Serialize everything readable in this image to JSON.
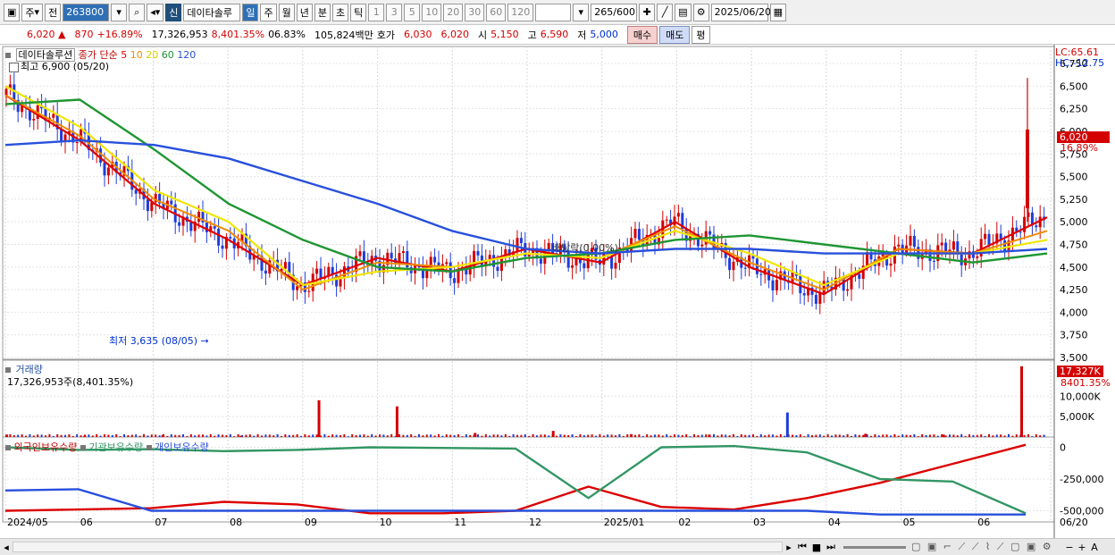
{
  "toolbar": {
    "period_label": "주",
    "prev_label": "전",
    "code": "263800",
    "stock_badge": "신",
    "stock_name": "데이타솔루",
    "periods": [
      "일",
      "주",
      "월",
      "년",
      "분",
      "초",
      "틱"
    ],
    "intervals": [
      "1",
      "3",
      "5",
      "10",
      "20",
      "30",
      "60",
      "120"
    ],
    "count_value": "265",
    "count_total": "/600",
    "date": "2025/06/20"
  },
  "quote": {
    "price": "6,020",
    "change": "870",
    "change_pct": "+16.89%",
    "volume": "17,326,953",
    "volume_ratio": "8,401.35%",
    "turnover": "06.83%",
    "amount": "105,824백만",
    "bid_label": "호가",
    "bid_ask": "6,030",
    "bid": "6,020",
    "open_label": "시",
    "open": "5,150",
    "high_label": "고",
    "high": "6,590",
    "low_label": "저",
    "low": "5,000",
    "buy_label": "매수",
    "sell_label": "매도",
    "eval_label": "평"
  },
  "main_legend": {
    "name": "데이타솔루션",
    "ma_label": "종가 단순",
    "ma_periods": [
      "5",
      "10",
      "20",
      "60",
      "120"
    ],
    "high_mark": "최고 6,900 (05/20)",
    "low_mark": "최저 3,635 (08/05)",
    "ex_div": "배당락(0.00%)",
    "lc": "LC:65.61",
    "hc": "HC:-12.75",
    "current_price": "6,020",
    "current_pct": "16.89%"
  },
  "volume_legend": {
    "title": "거래량",
    "value": "17,326,953주(8,401.35%)",
    "tag_value": "17,327K",
    "tag_pct": "8401.35%",
    "ticks": [
      "10,000K",
      "5,000K"
    ]
  },
  "holding_legend": {
    "items": [
      "외국인보유수량",
      "기관보유수량",
      "개인보유수량"
    ],
    "ticks": [
      "0",
      "-250,000",
      "-500,000"
    ]
  },
  "x_axis": [
    "2024/05",
    "06",
    "07",
    "08",
    "09",
    "10",
    "11",
    "12",
    "2025/01",
    "02",
    "03",
    "04",
    "05",
    "06",
    "06/20"
  ],
  "colors": {
    "up": "#d40000",
    "down": "#1e3cdc",
    "ma5": "#e00000",
    "ma10": "#f08c00",
    "ma20": "#f0e600",
    "ma60": "#1e9632",
    "ma120": "#2850dc",
    "foreign": "#dc0000",
    "inst": "#329664",
    "retail": "#2850dc"
  },
  "chart_data": [
    {
      "type": "line",
      "title": "",
      "ylim": [
        3500,
        6800
      ],
      "yticks": [
        6750,
        6500,
        6250,
        6000,
        5750,
        5500,
        5250,
        5000,
        4750,
        4500,
        4250,
        4000,
        3750,
        3500
      ],
      "x": [
        "2024/05/06",
        "2024/06",
        "2024/07",
        "2024/08",
        "2024/09",
        "2024/10",
        "2024/11",
        "2024/12",
        "2025/01",
        "2025/02",
        "2025/03",
        "2025/04",
        "2025/05",
        "2025/06",
        "2025/06/20"
      ],
      "series": [
        {
          "name": "5",
          "values": [
            6400,
            5900,
            5200,
            4800,
            4300,
            4600,
            4450,
            4700,
            4550,
            5000,
            4500,
            4200,
            4700,
            4650,
            5050
          ]
        },
        {
          "name": "10",
          "values": [
            6400,
            5950,
            5250,
            4900,
            4250,
            4550,
            4500,
            4650,
            4600,
            4950,
            4550,
            4250,
            4700,
            4650,
            4900
          ]
        },
        {
          "name": "20",
          "values": [
            6500,
            6050,
            5350,
            5000,
            4300,
            4450,
            4500,
            4650,
            4600,
            4900,
            4650,
            4300,
            4650,
            4650,
            4800
          ]
        },
        {
          "name": "60",
          "values": [
            6300,
            6350,
            5800,
            5200,
            4800,
            4500,
            4450,
            4600,
            4650,
            4800,
            4850,
            4750,
            4650,
            4550,
            4650
          ]
        },
        {
          "name": "120",
          "values": [
            5850,
            5900,
            5850,
            5700,
            5450,
            5200,
            4900,
            4700,
            4650,
            4700,
            4700,
            4650,
            4650,
            4650,
            4700
          ]
        }
      ]
    },
    {
      "type": "bar",
      "title": "거래량",
      "ylim": [
        0,
        17500
      ],
      "x": [
        "2024/05",
        "2024/07",
        "2024/08",
        "2024/09",
        "2024/10",
        "2024/11",
        "2024/12",
        "2025/01",
        "2025/02",
        "2025/03",
        "2025/04",
        "2025/05",
        "2025/06",
        "2025/06/20"
      ],
      "values": [
        600,
        300,
        500,
        300,
        9000,
        7500,
        1000,
        1500,
        700,
        600,
        6000,
        800,
        600,
        17327
      ]
    },
    {
      "type": "line",
      "ylim": [
        -560000,
        60000
      ],
      "x": [
        "2024/05",
        "2024/06",
        "2024/07",
        "2024/08",
        "2024/09",
        "2024/10",
        "2024/11",
        "2024/12",
        "2025/01",
        "2025/02",
        "2025/03",
        "2025/04",
        "2025/05",
        "2025/06",
        "2025/06/20"
      ],
      "series": [
        {
          "name": "외국인보유수량",
          "values": [
            -500000,
            -490000,
            -480000,
            -430000,
            -450000,
            -520000,
            -520000,
            -500000,
            -310000,
            -470000,
            -490000,
            -400000,
            -280000,
            -130000,
            20000
          ]
        },
        {
          "name": "기관보유수량",
          "values": [
            0,
            -20000,
            -15000,
            -30000,
            -20000,
            0,
            -5000,
            -10000,
            -400000,
            0,
            10000,
            -40000,
            -250000,
            -270000,
            -520000
          ]
        },
        {
          "name": "개인보유수량",
          "values": [
            -340000,
            -330000,
            -500000,
            -500000,
            -500000,
            -500000,
            -500000,
            -500000,
            -500000,
            -500000,
            -500000,
            -500000,
            -530000,
            -530000,
            -530000
          ]
        }
      ]
    }
  ]
}
